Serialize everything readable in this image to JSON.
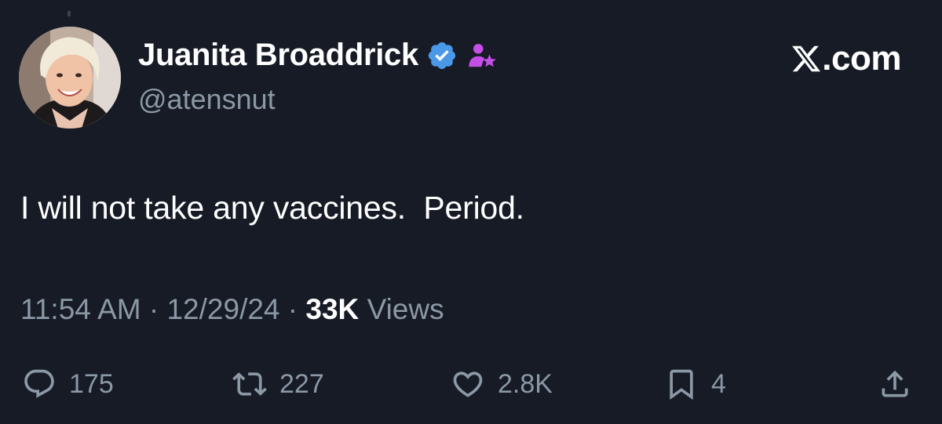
{
  "user": {
    "display_name": "Juanita Broaddrick",
    "handle": "@atensnut",
    "verified_badge_color": "#4a99e9",
    "affiliate_icon_color": "#c54ee6"
  },
  "brand": {
    "text": "X.com"
  },
  "tweet": {
    "text": "I will not take any vaccines.  Period.",
    "time": "11:54 AM",
    "date": "12/29/24",
    "views_count": "33K",
    "views_label": "Views",
    "separator": " · "
  },
  "actions": {
    "replies": "175",
    "reposts": "227",
    "likes": "2.8K",
    "bookmarks": "4"
  },
  "icons": [
    "verified-badge-icon",
    "affiliate-icon",
    "x-logo-icon",
    "reply-icon",
    "repost-icon",
    "like-icon",
    "bookmark-icon",
    "share-icon"
  ],
  "colors": {
    "background": "#161b26",
    "text": "#ffffff",
    "secondary": "#8b98a5"
  }
}
